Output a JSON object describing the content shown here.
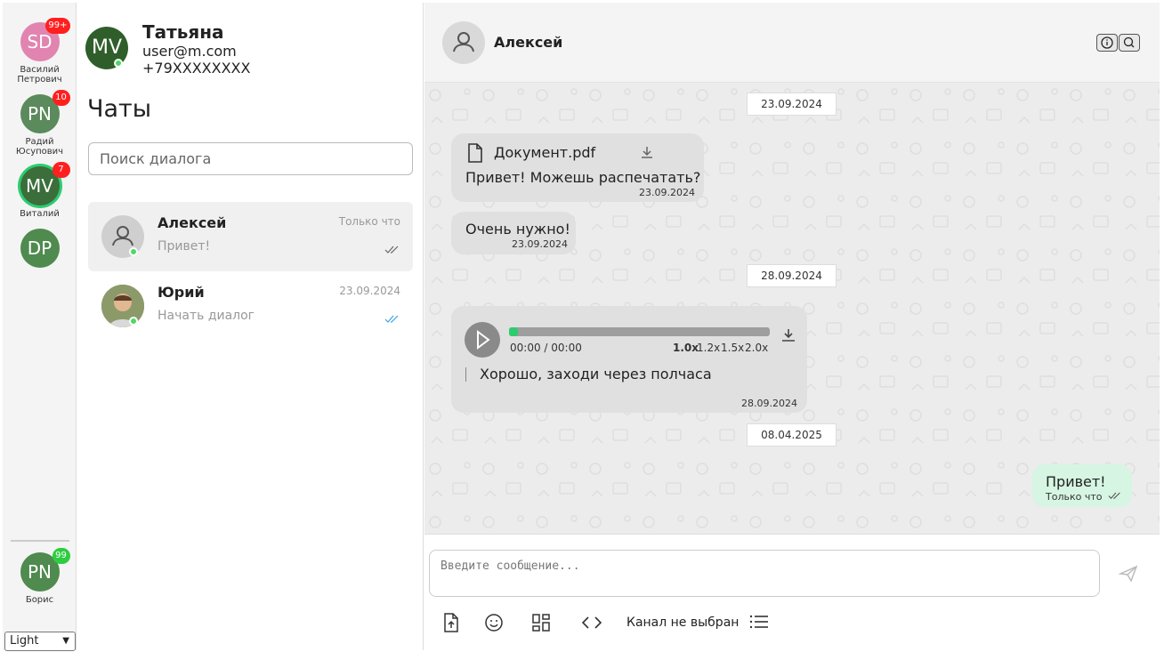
{
  "rail": {
    "contacts": [
      {
        "initials": "SD",
        "name": "Василий\nПетрович",
        "badge": "99+",
        "color": "#e184b0"
      },
      {
        "initials": "PN",
        "name": "Радий\nЮсупович",
        "badge": "10",
        "color": "#5b8a5c"
      },
      {
        "initials": "MV",
        "name": "Виталий",
        "badge": "7",
        "color": "#3b6e3b"
      },
      {
        "initials": "DP",
        "name": "",
        "badge": "",
        "color": "#4f8a4f"
      }
    ],
    "self": {
      "initials": "PN",
      "name": "Борис",
      "badge": "99",
      "color": "#4f8a4f"
    },
    "theme_select": "Light"
  },
  "profile": {
    "initials": "MV",
    "name": "Татьяна",
    "email": "user@m.com",
    "phone": "+79XXXXXXXX"
  },
  "chats": {
    "title": "Чаты",
    "search_placeholder": "Поиск диалога",
    "items": [
      {
        "name": "Алексей",
        "time": "Только что",
        "preview": "Привет!"
      },
      {
        "name": "Юрий",
        "time": "23.09.2024",
        "preview": "Начать диалог"
      }
    ]
  },
  "conversation": {
    "peer_name": "Алексей",
    "messages": {
      "date1": "23.09.2024",
      "doc_name": "Документ.pdf",
      "msg1_text": "Привет! Можешь распечатать?",
      "msg1_time": "23.09.2024",
      "msg2_text": "Очень нужно!",
      "msg2_time": "23.09.2024",
      "date2": "28.09.2024",
      "audio_time": "00:00 / 00:00",
      "speeds": [
        "1.0x",
        "1.2x",
        "1.5x",
        "2.0x"
      ],
      "audio_caption": "Хорошо, заходи через полчаса",
      "audio_msg_time": "28.09.2024",
      "date3": "08.04.2025",
      "out_text": "Привет!",
      "out_time": "Только что"
    },
    "composer": {
      "placeholder": "Введите сообщение...",
      "channel_label": "Канал не выбран"
    }
  },
  "colors": {
    "accent": "#2ecc71",
    "badge_red": "#ff1f1f",
    "online": "#4cd964",
    "check_read": "#3aa3e3"
  }
}
